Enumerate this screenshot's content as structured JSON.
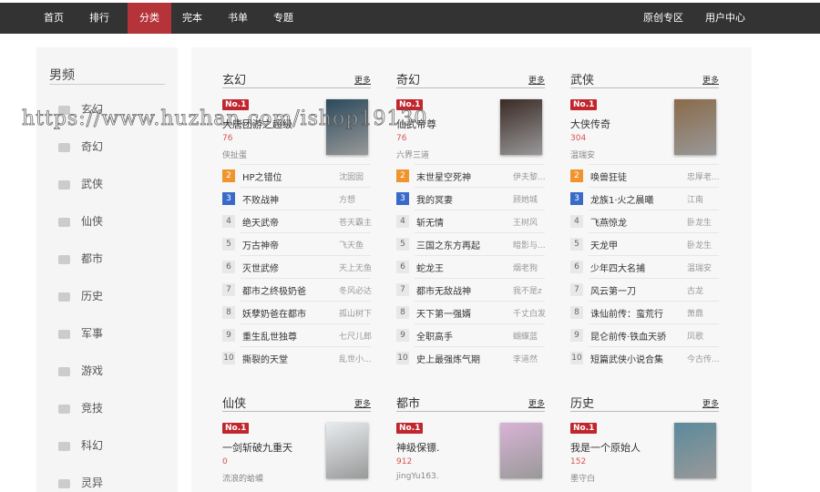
{
  "nav": {
    "left": [
      "首页",
      "排行",
      "分类",
      "完本",
      "书单",
      "专题"
    ],
    "right": [
      "原创专区",
      "用户中心"
    ],
    "active": "分类"
  },
  "sidebar": {
    "title": "男频",
    "items": [
      "玄幻",
      "奇幻",
      "武侠",
      "仙侠",
      "都市",
      "历史",
      "军事",
      "游戏",
      "竞技",
      "科幻",
      "灵异"
    ]
  },
  "more_label": "更多",
  "no1_label": "No.1",
  "sections": [
    {
      "name": "玄幻",
      "top": {
        "title": "大唐团游之超级",
        "count": "76",
        "author": "侠扯蛋",
        "cover": "#2b4a5c"
      },
      "list": [
        [
          "HP之错位",
          "沈囡囡"
        ],
        [
          "不败战神",
          "方想"
        ],
        [
          "绝天武帝",
          "苍天霸主"
        ],
        [
          "万古神帝",
          "飞天鱼"
        ],
        [
          "灭世武修",
          "天上无鱼"
        ],
        [
          "都市之终极奶爸",
          "冬风必达"
        ],
        [
          "妖孽奶爸在都市",
          "孤山树下"
        ],
        [
          "重生乱世独尊",
          "七尺儿郎"
        ],
        [
          "撕裂的天堂",
          "乱世小..."
        ]
      ]
    },
    {
      "name": "奇幻",
      "top": {
        "title": "仙武帝尊",
        "count": "76",
        "author": "六界三道",
        "cover": "#3a2a26"
      },
      "list": [
        [
          "末世星空死神",
          "伊夫黎..."
        ],
        [
          "我的冥妻",
          "顾她城"
        ],
        [
          "斩无情",
          "王树风"
        ],
        [
          "三国之东方再起",
          "暗影与..."
        ],
        [
          "蛇龙王",
          "烟老狗"
        ],
        [
          "都市无敌战神",
          "我不是z"
        ],
        [
          "天下第一强婿",
          "千丈白发"
        ],
        [
          "全职高手",
          "蝴蝶蓝"
        ],
        [
          "史上最强炼气期",
          "李道然"
        ]
      ]
    },
    {
      "name": "武侠",
      "top": {
        "title": "大侠传奇",
        "count": "304",
        "author": "温瑞安",
        "cover": "#8a6a4a"
      },
      "list": [
        [
          "唤兽狂徒",
          "忠厚老..."
        ],
        [
          "龙族1·火之晨曦",
          "江南"
        ],
        [
          "飞燕惊龙",
          "卧龙生"
        ],
        [
          "天龙甲",
          "卧龙生"
        ],
        [
          "少年四大名捕",
          "温瑞安"
        ],
        [
          "风云第一刀",
          "古龙"
        ],
        [
          "诛仙前传：蛮荒行",
          "萧鼎"
        ],
        [
          "昆仑前传·铁血天骄",
          "凤歌"
        ],
        [
          "短篇武侠小说合集",
          "今古传..."
        ]
      ]
    },
    {
      "name": "仙侠",
      "top": {
        "title": "一剑斩破九重天",
        "count": "0",
        "author": "流浪的蛤蟆",
        "cover": "#e8ecef"
      },
      "list": []
    },
    {
      "name": "都市",
      "top": {
        "title": "神级保镖.",
        "count": "912",
        "author": "jingYu163.",
        "cover": "#d9b3d6"
      },
      "list": []
    },
    {
      "name": "历史",
      "top": {
        "title": "我是一个原始人",
        "count": "152",
        "author": "墨守白",
        "cover": "#5b8a9c"
      },
      "list": []
    }
  ],
  "watermark": "https://www.huzhan.com/ishop19130"
}
